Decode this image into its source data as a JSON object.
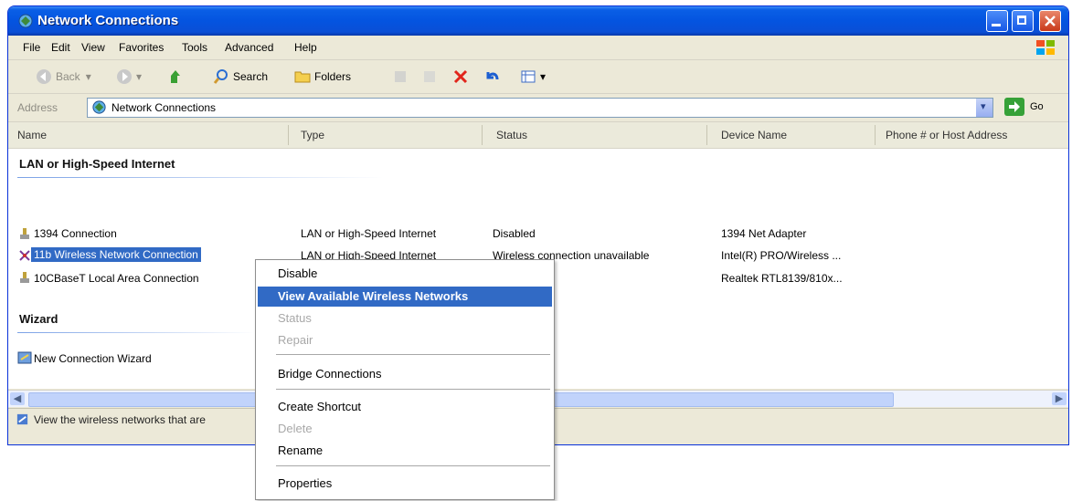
{
  "window": {
    "title": "Network Connections"
  },
  "menubar": [
    "File",
    "Edit",
    "View",
    "Favorites",
    "Tools",
    "Advanced",
    "Help"
  ],
  "toolbar": {
    "back": "Back",
    "search": "Search",
    "folders": "Folders"
  },
  "address": {
    "label": "Address",
    "value": "Network Connections",
    "go": "Go"
  },
  "columns": [
    "Name",
    "Type",
    "Status",
    "Device Name",
    "Phone # or Host Address"
  ],
  "groups": {
    "lan": "LAN or High-Speed Internet",
    "wizard": "Wizard"
  },
  "rows": [
    {
      "name": "1394 Connection",
      "type": "LAN or High-Speed Internet",
      "status": "Disabled",
      "device": "1394 Net Adapter",
      "icon": "lan-connection-icon"
    },
    {
      "name": "11b Wireless Network Connection",
      "type": "LAN or High-Speed Internet",
      "status": "Wireless connection unavailable",
      "device": "Intel(R) PRO/Wireless ...",
      "icon": "wireless-connection-icon"
    },
    {
      "name": "10CBaseT Local Area Connection",
      "type": "",
      "status": "",
      "device": "Realtek RTL8139/810x...",
      "icon": "lan-connection-icon"
    }
  ],
  "wizard_item": {
    "name": "New Connection Wizard",
    "icon": "wizard-icon"
  },
  "status_text": "View the wireless networks that are",
  "context_menu": [
    {
      "label": "Disable",
      "enabled": true
    },
    {
      "label": "View Available Wireless Networks",
      "enabled": true,
      "highlighted": true
    },
    {
      "label": "Status",
      "enabled": false
    },
    {
      "label": "Repair",
      "enabled": false
    },
    {
      "label": "Bridge Connections",
      "enabled": true
    },
    {
      "label": "Create Shortcut",
      "enabled": true
    },
    {
      "label": "Delete",
      "enabled": false
    },
    {
      "label": "Rename",
      "enabled": true
    },
    {
      "label": "Properties",
      "enabled": true
    }
  ],
  "colors": {
    "titlebar": "#0454e0",
    "selection": "#316ac5",
    "chrome": "#ece9d8"
  }
}
